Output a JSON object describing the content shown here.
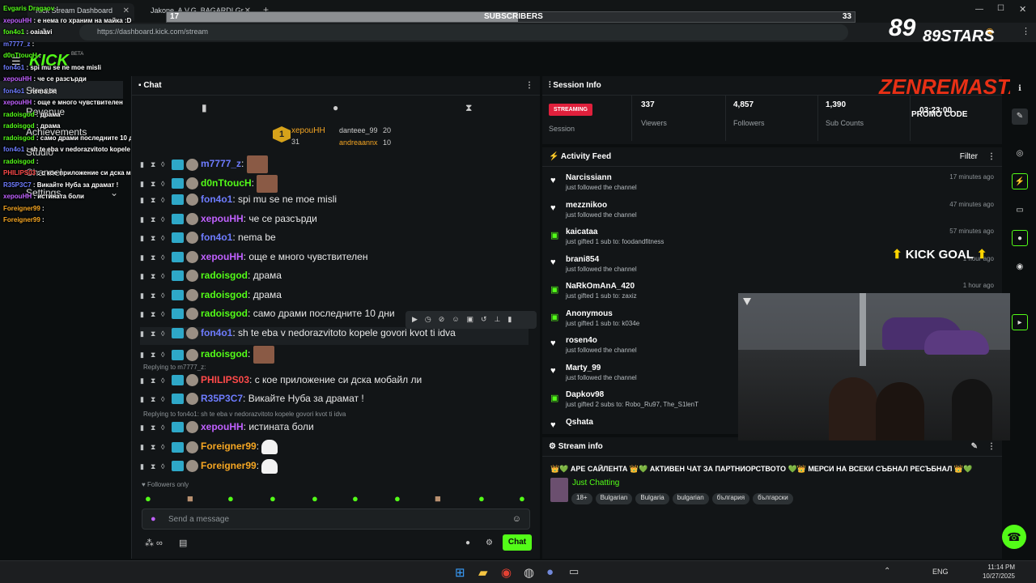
{
  "browser": {
    "tabs": [
      {
        "label": "Kick Stream Dashboard"
      },
      {
        "label": "Jakone, A.V.G. BAGARDI Gr..."
      }
    ],
    "url": "https://dashboard.kick.com/stream"
  },
  "sub_goal": {
    "left": "17",
    "title": "SUBSCRIBERS",
    "right": "33",
    "fraction": 0.51
  },
  "sidebar": {
    "logo": "KICK",
    "logo_tag": "BETA",
    "items": [
      {
        "label": "Stream"
      },
      {
        "label": "Revenue"
      },
      {
        "label": "Achievements"
      },
      {
        "label": "Studio"
      },
      {
        "label": "Channel"
      },
      {
        "label": "Settings"
      }
    ]
  },
  "overlay_chat": [
    {
      "user": "Evgaris Dragaov",
      "msg": "",
      "color": "#53fc18"
    },
    {
      "user": "xepouHH",
      "msg": "е нема го храним на майка :D",
      "color": "#c061ff"
    },
    {
      "user": "fon4o1",
      "msg": "oaiaavi",
      "color": "#53fc18"
    },
    {
      "user": "m7777_z",
      "msg": "",
      "color": "#6e7cff"
    },
    {
      "user": "d0nTtoucH",
      "msg": "",
      "color": "#53fc18"
    },
    {
      "user": "fon4o1",
      "msg": "spi mu se ne moe misli",
      "color": "#6e7cff"
    },
    {
      "user": "xepouHH",
      "msg": "че се разсърди",
      "color": "#c061ff"
    },
    {
      "user": "fon4o1",
      "msg": "nema be",
      "color": "#6e7cff"
    },
    {
      "user": "xepouHH",
      "msg": "още е много чувствителен",
      "color": "#c061ff"
    },
    {
      "user": "radoisgod",
      "msg": "драма",
      "color": "#53fc18"
    },
    {
      "user": "radoisgod",
      "msg": "драма",
      "color": "#53fc18"
    },
    {
      "user": "radoisgod",
      "msg": "само драми последните 10 дни",
      "color": "#53fc18"
    },
    {
      "user": "fon4o1",
      "msg": "sh te eba v nedorazvitoto kopele govori kvot ti idva",
      "color": "#6e7cff"
    },
    {
      "user": "radoisgod",
      "msg": "",
      "color": "#53fc18"
    },
    {
      "user": "PHILIPS03",
      "msg": "с кое приложение си дска мобайл ли",
      "color": "#ff4a4a"
    },
    {
      "user": "R35P3C7",
      "msg": "Викайте Нуба за драмат !",
      "color": "#6e7cff"
    },
    {
      "user": "xepouHH",
      "msg": "истината боли",
      "color": "#c061ff"
    },
    {
      "user": "Foreigner99",
      "msg": "",
      "color": "#f5a623"
    },
    {
      "user": "Foreigner99",
      "msg": "",
      "color": "#f5a623"
    }
  ],
  "chat": {
    "title": "Chat",
    "leaderboard": [
      {
        "rank": "1",
        "user": "xepouHH",
        "count": "31"
      },
      {
        "user": "danteee_99",
        "count": "20"
      },
      {
        "user": "andreaannx",
        "count": "10"
      }
    ],
    "messages": [
      {
        "user": "m7777_z",
        "msg": "",
        "color": "#6e7cff",
        "reply": ""
      },
      {
        "user": "d0nTtoucH",
        "msg": "",
        "color": "#53fc18",
        "reply": ""
      },
      {
        "user": "fon4o1",
        "msg": "spi mu se ne moe misli",
        "color": "#6e7cff",
        "reply": ""
      },
      {
        "user": "xepouHH",
        "msg": "че се разсърди",
        "color": "#c061ff",
        "reply": ""
      },
      {
        "user": "fon4o1",
        "msg": "nema be",
        "color": "#6e7cff",
        "reply": ""
      },
      {
        "user": "xepouHH",
        "msg": "още е много чувствителен",
        "color": "#c061ff",
        "reply": ""
      },
      {
        "user": "radoisgod",
        "msg": "драма",
        "color": "#53fc18",
        "reply": ""
      },
      {
        "user": "radoisgod",
        "msg": "драма",
        "color": "#53fc18",
        "reply": ""
      },
      {
        "user": "radoisgod",
        "msg": "само драми последните 10 дни",
        "color": "#53fc18",
        "reply": ""
      },
      {
        "user": "fon4o1",
        "msg": "sh te eba v nedorazvitoto kopele govori kvot ti idva",
        "color": "#6e7cff",
        "reply": ""
      },
      {
        "user": "radoisgod",
        "msg": "",
        "color": "#53fc18",
        "reply": ""
      },
      {
        "user": "PHILIPS03",
        "msg": "с кое приложение си дска мобайл ли",
        "color": "#ff4a4a",
        "reply": "Replying to m7777_z:"
      },
      {
        "user": "R35P3C7",
        "msg": "Викайте Нуба за драмат !",
        "color": "#6e7cff",
        "reply": ""
      },
      {
        "user": "xepouHH",
        "msg": "истината боли",
        "color": "#c061ff",
        "reply": "Replying to fon4o1: sh te eba v nedorazvitoto kopele govori kvot ti idva"
      },
      {
        "user": "Foreigner99",
        "msg": "",
        "color": "#f5a623",
        "reply": ""
      },
      {
        "user": "Foreigner99",
        "msg": "",
        "color": "#f5a623",
        "reply": ""
      }
    ],
    "followers_only": "Followers only",
    "input_placeholder": "Send a message",
    "send_label": "Chat"
  },
  "session": {
    "title": "Session Info",
    "status": "STREAMING",
    "session_label": "Session",
    "viewers": "337",
    "viewers_label": "Viewers",
    "followers": "4,857",
    "followers_label": "Followers",
    "subs": "1,390",
    "subs_label": "Sub Counts",
    "time": "03:23:00"
  },
  "activity": {
    "title": "Activity Feed",
    "filter": "Filter",
    "items": [
      {
        "user": "Narcissiann",
        "text": "just followed the channel",
        "when": "17 minutes ago",
        "type": "follow"
      },
      {
        "user": "mezznikoo",
        "text": "just followed the channel",
        "when": "47 minutes ago",
        "type": "follow"
      },
      {
        "user": "kaicataa",
        "text": "just gifted 1 sub to: foodandfitness",
        "when": "57 minutes ago",
        "type": "gift"
      },
      {
        "user": "brani854",
        "text": "just followed the channel",
        "when": "1 hour ago",
        "type": "follow"
      },
      {
        "user": "NaRkOmAnA_420",
        "text": "just gifted 1 sub to: zaxiz",
        "when": "1 hour ago",
        "type": "gift"
      },
      {
        "user": "Anonymous",
        "text": "just gifted 1 sub to: k034e",
        "when": "",
        "type": "gift"
      },
      {
        "user": "rosen4o",
        "text": "just followed the channel",
        "when": "",
        "type": "follow"
      },
      {
        "user": "Marty_99",
        "text": "just followed the channel",
        "when": "",
        "type": "follow"
      },
      {
        "user": "Dapkov98",
        "text": "just gifted 2 subs to: Robo_Ru97, The_S1lenT",
        "when": "",
        "type": "gift"
      },
      {
        "user": "Qshata",
        "text": "",
        "when": "",
        "type": "follow"
      }
    ]
  },
  "stream_info": {
    "title": "Stream info",
    "stream_title": "👑💚 АРЕ САЙЛЕНТА 👑💚 АКТИВЕН ЧАТ ЗА ПАРТНИОРСТВОТО 💚👑 МЕРСИ НА ВСЕКИ СЪБНАЛ РЕСЪБНАЛ 👑💚",
    "category": "Just Chatting",
    "tags": [
      "18+",
      "Bulgarian",
      "Bulgaria",
      "bulgarian",
      "българия",
      "български"
    ]
  },
  "overlay": {
    "brand": "89STARS",
    "brand2": "ZENREMASTA",
    "promo": "PROMO CODE",
    "goal": "KICK GOAL"
  },
  "taskbar": {
    "lang": "ENG",
    "time": "11:14 PM",
    "date": "10/27/2025"
  }
}
